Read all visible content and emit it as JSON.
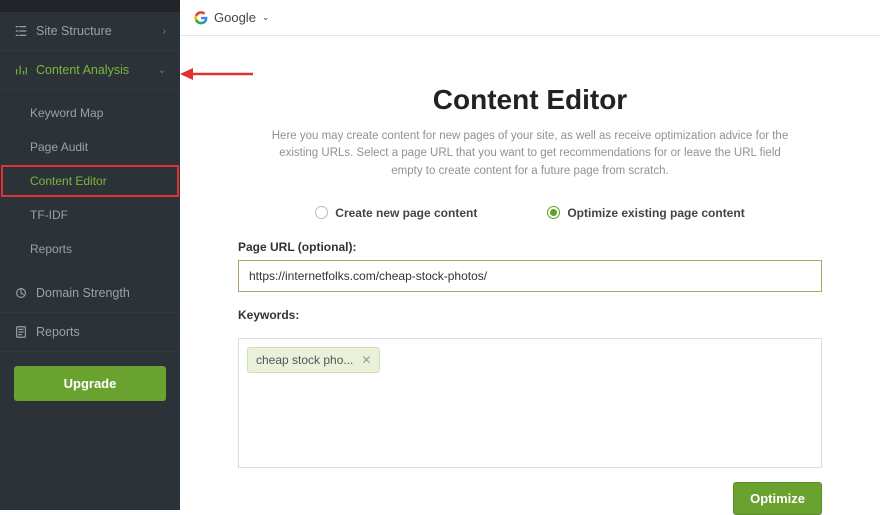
{
  "sidebar": {
    "sections": [
      {
        "label": "Site Structure"
      },
      {
        "label": "Content Analysis"
      },
      {
        "label": "Domain Strength"
      },
      {
        "label": "Reports"
      }
    ],
    "content_analysis_items": [
      {
        "label": "Keyword Map"
      },
      {
        "label": "Page Audit"
      },
      {
        "label": "Content Editor"
      },
      {
        "label": "TF-IDF"
      },
      {
        "label": "Reports"
      }
    ],
    "upgrade_label": "Upgrade"
  },
  "topbar": {
    "search_engine": "Google"
  },
  "hero": {
    "title": "Content Editor",
    "description": "Here you may create content for new pages of your site, as well as receive optimization advice for the existing URLs. Select a page URL that you want to get recommendations for or leave the URL field empty to create content for a future page from scratch."
  },
  "options": {
    "create": "Create new page content",
    "optimize": "Optimize existing page content"
  },
  "form": {
    "url_label": "Page URL (optional):",
    "url_value": "https://internetfolks.com/cheap-stock-photos/",
    "keywords_label": "Keywords:",
    "keyword_tag": "cheap stock pho...",
    "optimize_btn": "Optimize"
  }
}
